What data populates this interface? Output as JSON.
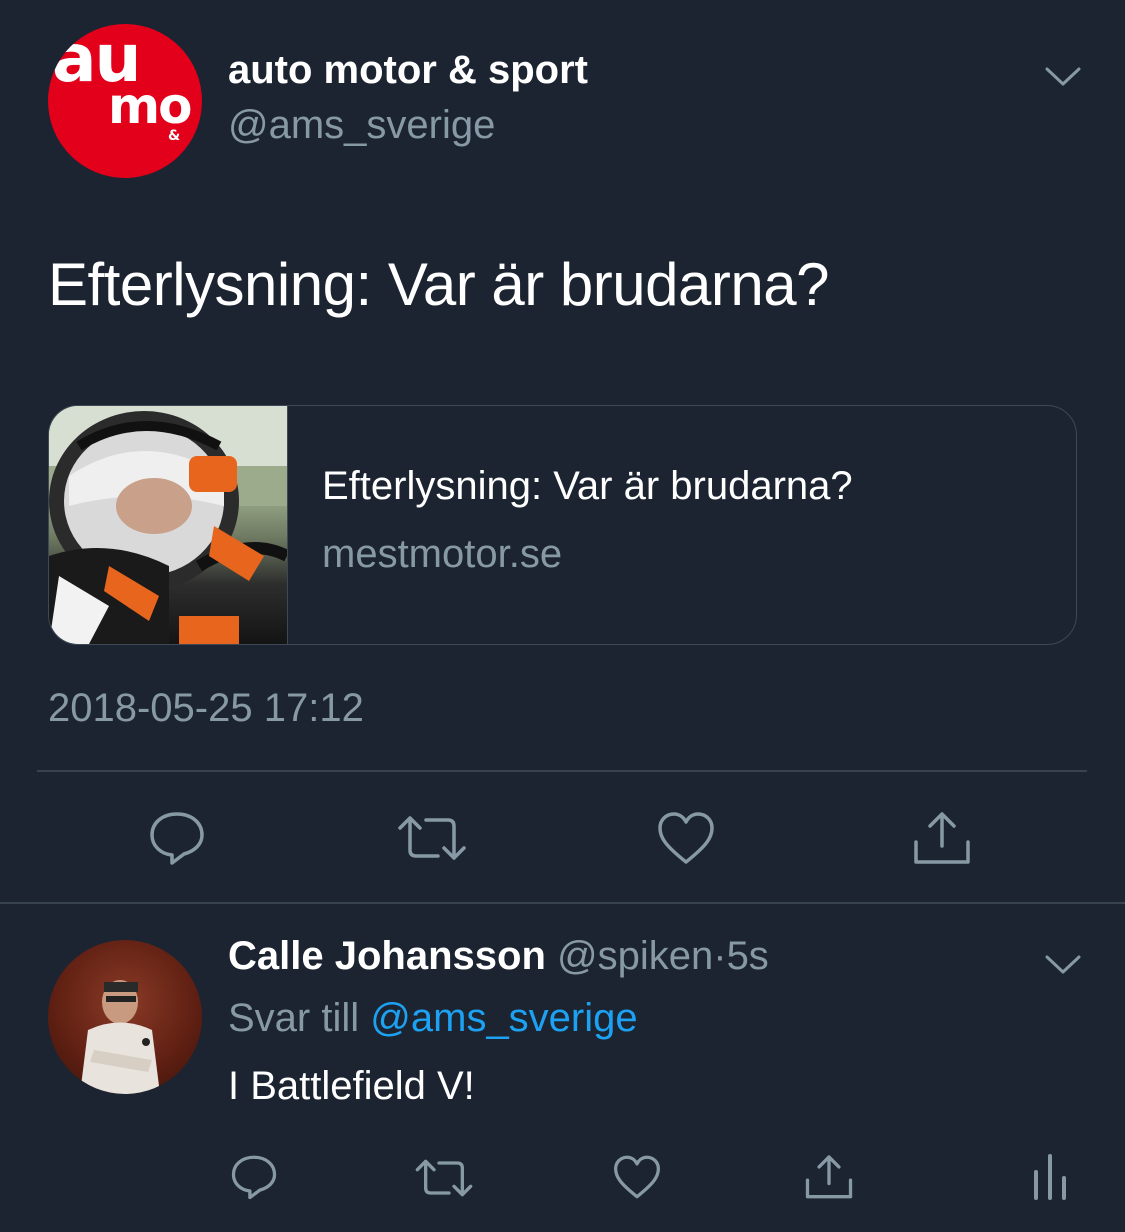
{
  "tweet": {
    "author_name": "auto motor & sport",
    "author_handle": "@ams_sverige",
    "avatar_logo_text": [
      "au",
      "mo",
      "& s"
    ],
    "text": "Efterlysning: Var är brudarna?",
    "card": {
      "title": "Efterlysning: Var är brudarna?",
      "domain": "mestmotor.se"
    },
    "timestamp": "2018-05-25 17:12",
    "actions": [
      "reply-icon",
      "retweet-icon",
      "like-icon",
      "share-icon"
    ]
  },
  "reply": {
    "author_name": "Calle Johansson",
    "author_handle": "@spiken",
    "separator": "·",
    "time": "5s",
    "reply_prefix": "Svar till",
    "reply_mention": "@ams_sverige",
    "text": "I Battlefield V!",
    "actions": [
      "reply-icon",
      "retweet-icon",
      "like-icon",
      "share-icon",
      "analytics-icon"
    ]
  },
  "colors": {
    "background": "#1b2430",
    "secondary_text": "#8899a6",
    "link": "#1da1f2",
    "divider": "#38444d",
    "brand_red": "#e2001a"
  }
}
